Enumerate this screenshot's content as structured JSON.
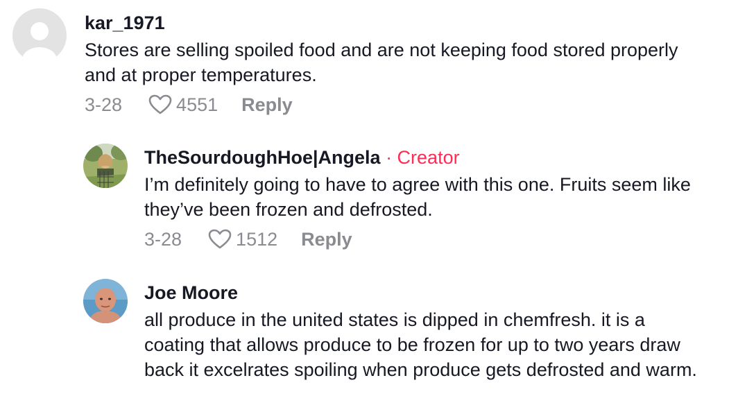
{
  "comments": [
    {
      "username": "kar_1971",
      "badge": "",
      "text": "Stores are selling spoiled food and are not keeping food stored properly and at proper temperatures.",
      "date": "3-28",
      "likes": "4551",
      "reply_label": "Reply"
    },
    {
      "username": "TheSourdoughHoe|Angela",
      "badge": "· Creator",
      "text": "I’m definitely going to have to agree with this one. Fruits seem like they’ve been frozen and defrosted.",
      "date": "3-28",
      "likes": "1512",
      "reply_label": "Reply"
    },
    {
      "username": "Joe Moore",
      "badge": "",
      "text": "all produce in the united states is dipped in chemfresh. it is a coating that allows produce to be frozen for up to two years draw back it excelrates spoiling when produce gets defrosted and warm."
    }
  ],
  "colors": {
    "creator_badge": "#fe2c55",
    "meta_text": "#8a8b91",
    "primary_text": "#161823"
  },
  "icons": {
    "like": "heart-outline-icon",
    "default_avatar": "default-avatar-icon"
  }
}
